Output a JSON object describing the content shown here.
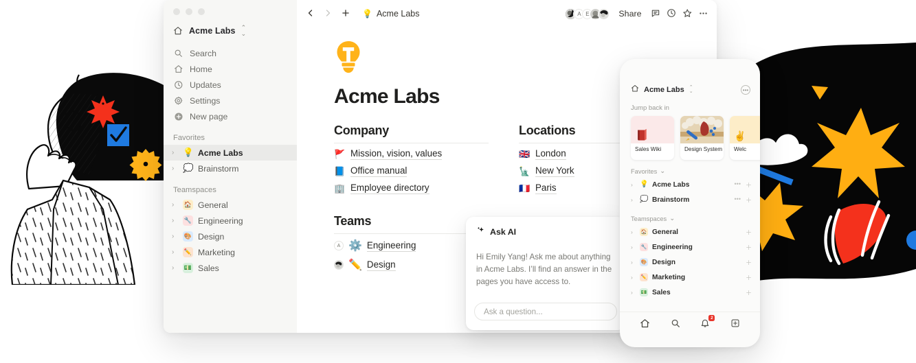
{
  "window": {
    "traffic_lights": [
      "close",
      "minimize",
      "maximize"
    ],
    "sidebar": {
      "workspace": {
        "name": "Acme Labs",
        "icon": "home-icon",
        "switcher": "switcher-icon"
      },
      "nav": [
        {
          "label": "Search",
          "icon": "search-icon"
        },
        {
          "label": "Home",
          "icon": "home-icon"
        },
        {
          "label": "Updates",
          "icon": "clock-icon"
        },
        {
          "label": "Settings",
          "icon": "gear-icon"
        },
        {
          "label": "New page",
          "icon": "plus-circle-icon"
        }
      ],
      "favorites_label": "Favorites",
      "favorites": [
        {
          "label": "Acme Labs",
          "emoji": "💡",
          "selected": true
        },
        {
          "label": "Brainstorm",
          "emoji": "💭",
          "selected": false
        }
      ],
      "teamspaces_label": "Teamspaces",
      "teamspaces": [
        {
          "label": "General",
          "emoji": "🏠",
          "bg": "#fdeec9"
        },
        {
          "label": "Engineering",
          "emoji": "🔧",
          "bg": "#fde0e0"
        },
        {
          "label": "Design",
          "emoji": "🎨",
          "bg": "#d9eafd"
        },
        {
          "label": "Marketing",
          "emoji": "✏️",
          "bg": "#fde3cf"
        },
        {
          "label": "Sales",
          "emoji": "💵",
          "bg": "#d8f0dd"
        }
      ]
    },
    "topbar": {
      "back_icon": "chevron-left-icon",
      "forward_icon": "chevron-right-icon",
      "new_icon": "plus-icon",
      "breadcrumb_emoji": "💡",
      "breadcrumb": "Acme Labs",
      "avatars": [
        "",
        "A",
        "E",
        "",
        ""
      ],
      "share_label": "Share",
      "comment_icon": "comment-icon",
      "history_icon": "clock-icon",
      "favorite_icon": "star-icon",
      "more_icon": "more-horizontal-icon"
    },
    "page": {
      "icon_letter": "T",
      "title": "Acme Labs",
      "columns": [
        {
          "heading": "Company",
          "links": [
            {
              "emoji": "🚩",
              "label": "Mission, vision, values"
            },
            {
              "emoji": "📘",
              "label": "Office manual"
            },
            {
              "emoji": "🏢",
              "label": "Employee directory"
            }
          ]
        },
        {
          "heading": "Locations",
          "links": [
            {
              "emoji": "🇬🇧",
              "label": "London"
            },
            {
              "emoji": "🗽",
              "label": "New York"
            },
            {
              "emoji": "🇫🇷",
              "label": "Paris"
            }
          ]
        }
      ],
      "teams_heading": "Teams",
      "teams": [
        {
          "avatar": "A",
          "emoji": "⚙️",
          "label": "Engineering"
        },
        {
          "avatar": "",
          "emoji": "✏️",
          "label": "Design"
        }
      ]
    }
  },
  "ask_ai": {
    "sparkle_icon": "sparkle-icon",
    "title": "Ask AI",
    "greeting": "Hi Emily Yang! Ask me about anything in Acme Labs. I’ll find an answer in the pages you have access to.",
    "input_placeholder": "Ask a question..."
  },
  "phone": {
    "workspace": "Acme Labs",
    "home_icon": "home-icon",
    "switcher_icon": "switcher-icon",
    "more_icon": "more-circle-icon",
    "jump_back_label": "Jump back in",
    "cards": [
      {
        "label": "Sales Wiki",
        "bg": "#fbe9e9"
      },
      {
        "label": "Design System",
        "bg": "#e8d8bb"
      },
      {
        "label": "Welc",
        "bg": "#fdedc8"
      }
    ],
    "favorites_label": "Favorites",
    "favorites": [
      {
        "label": "Acme Labs",
        "emoji": "💡"
      },
      {
        "label": "Brainstorm",
        "emoji": "💭"
      }
    ],
    "teamspaces_label": "Teamspaces",
    "teamspaces": [
      {
        "label": "General",
        "emoji": "🏠",
        "bg": "#fdeec9"
      },
      {
        "label": "Engineering",
        "emoji": "🔧",
        "bg": "#fde0e0"
      },
      {
        "label": "Design",
        "emoji": "🎨",
        "bg": "#d9eafd"
      },
      {
        "label": "Marketing",
        "emoji": "✏️",
        "bg": "#fde3cf"
      },
      {
        "label": "Sales",
        "emoji": "💵",
        "bg": "#d8f0dd"
      }
    ],
    "tabbar": [
      {
        "icon": "home-icon",
        "badge": ""
      },
      {
        "icon": "search-icon",
        "badge": ""
      },
      {
        "icon": "bell-icon",
        "badge": "2"
      },
      {
        "icon": "new-page-icon",
        "badge": ""
      }
    ]
  },
  "colors": {
    "brand_yellow": "#ffb31a",
    "accent_red": "#f4311c",
    "accent_blue": "#1f7ae0",
    "sidebar_bg": "#f7f7f5",
    "selected_bg": "#eaeae8"
  }
}
